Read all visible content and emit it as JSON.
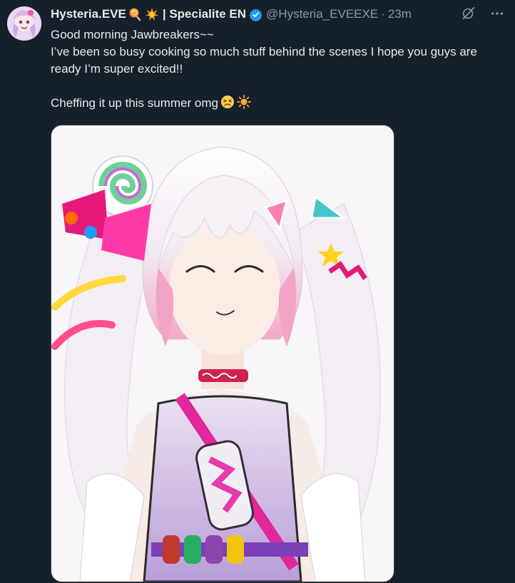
{
  "tweet": {
    "display_name": "Hysteria.EVE",
    "name_suffix": "| Specialite EN",
    "handle": "@Hysteria_EVEEXE",
    "separator": "·",
    "time": "23m",
    "lines": [
      "Good morning Jawbreakers~~",
      "I’ve been so busy cooking so much stuff behind the scenes I hope you guys are ready I’m super excited!!"
    ],
    "line_last": "Cheffing it up this summer omg"
  },
  "icons": {
    "name_emoji_1": "lollipop-icon",
    "name_emoji_2": "collision-icon",
    "verified": "verified-badge-icon",
    "grok": "grok-icon",
    "more": "more-icon",
    "inline_1": "persevering-face-icon",
    "inline_2": "sun-icon"
  },
  "colors": {
    "background": "#15202b",
    "text": "#e7e9ea",
    "muted": "#8b98a5",
    "verified": "#1d9bf0"
  }
}
